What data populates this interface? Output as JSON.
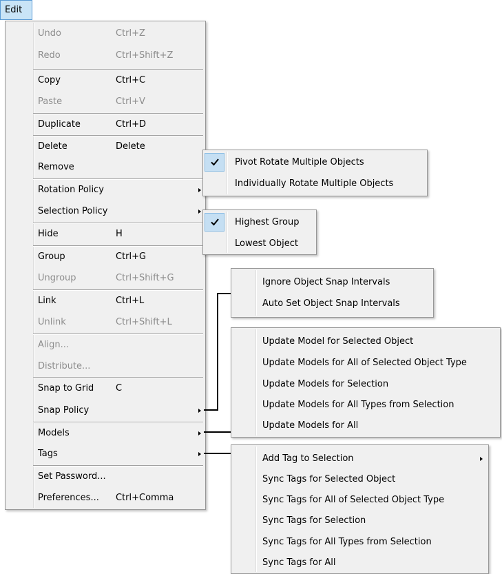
{
  "menubar": {
    "edit_label": "Edit"
  },
  "edit_menu": {
    "undo": {
      "label": "Undo",
      "shortcut": "Ctrl+Z"
    },
    "redo": {
      "label": "Redo",
      "shortcut": "Ctrl+Shift+Z"
    },
    "copy": {
      "label": "Copy",
      "shortcut": "Ctrl+C"
    },
    "paste": {
      "label": "Paste",
      "shortcut": "Ctrl+V"
    },
    "duplicate": {
      "label": "Duplicate",
      "shortcut": "Ctrl+D"
    },
    "delete": {
      "label": "Delete",
      "shortcut": "Delete"
    },
    "remove": {
      "label": "Remove"
    },
    "rotation_policy": {
      "label": "Rotation Policy"
    },
    "selection_policy": {
      "label": "Selection Policy"
    },
    "hide": {
      "label": "Hide",
      "shortcut": "H"
    },
    "group": {
      "label": "Group",
      "shortcut": "Ctrl+G"
    },
    "ungroup": {
      "label": "Ungroup",
      "shortcut": "Ctrl+Shift+G"
    },
    "link": {
      "label": "Link",
      "shortcut": "Ctrl+L"
    },
    "unlink": {
      "label": "Unlink",
      "shortcut": "Ctrl+Shift+L"
    },
    "align": {
      "label": "Align..."
    },
    "distribute": {
      "label": "Distribute..."
    },
    "snap_to_grid": {
      "label": "Snap to Grid",
      "shortcut": "C"
    },
    "snap_policy": {
      "label": "Snap Policy"
    },
    "models": {
      "label": "Models"
    },
    "tags": {
      "label": "Tags"
    },
    "set_password": {
      "label": "Set Password..."
    },
    "preferences": {
      "label": "Preferences...",
      "shortcut": "Ctrl+Comma"
    }
  },
  "rotation_submenu": {
    "pivot": {
      "label": "Pivot Rotate Multiple Objects",
      "checked": true
    },
    "individual": {
      "label": "Individually Rotate Multiple Objects",
      "checked": false
    }
  },
  "selection_submenu": {
    "highest": {
      "label": "Highest Group",
      "checked": true
    },
    "lowest": {
      "label": "Lowest Object",
      "checked": false
    }
  },
  "snap_submenu": {
    "ignore": {
      "label": "Ignore Object Snap Intervals"
    },
    "auto": {
      "label": "Auto Set Object Snap Intervals"
    }
  },
  "models_submenu": {
    "selected_object": {
      "label": "Update Model for Selected Object"
    },
    "all_selected_type": {
      "label": "Update Models for All of Selected Object Type"
    },
    "selection": {
      "label": "Update Models for Selection"
    },
    "all_types_selection": {
      "label": "Update Models for All Types from Selection"
    },
    "all": {
      "label": "Update Models for All"
    }
  },
  "tags_submenu": {
    "add_tag": {
      "label": "Add Tag to Selection"
    },
    "selected_object": {
      "label": "Sync Tags for Selected Object"
    },
    "all_selected_type": {
      "label": "Sync Tags for All of Selected Object Type"
    },
    "selection": {
      "label": "Sync Tags for Selection"
    },
    "all_types_selection": {
      "label": "Sync Tags for All Types from Selection"
    },
    "all": {
      "label": "Sync Tags for All"
    }
  },
  "theme": {
    "menu_background": "#f0f0f0",
    "menu_border": "#979797",
    "highlight": "#c9e4f7",
    "check_background": "#c5dff3",
    "disabled_text": "#8d8d8d"
  }
}
